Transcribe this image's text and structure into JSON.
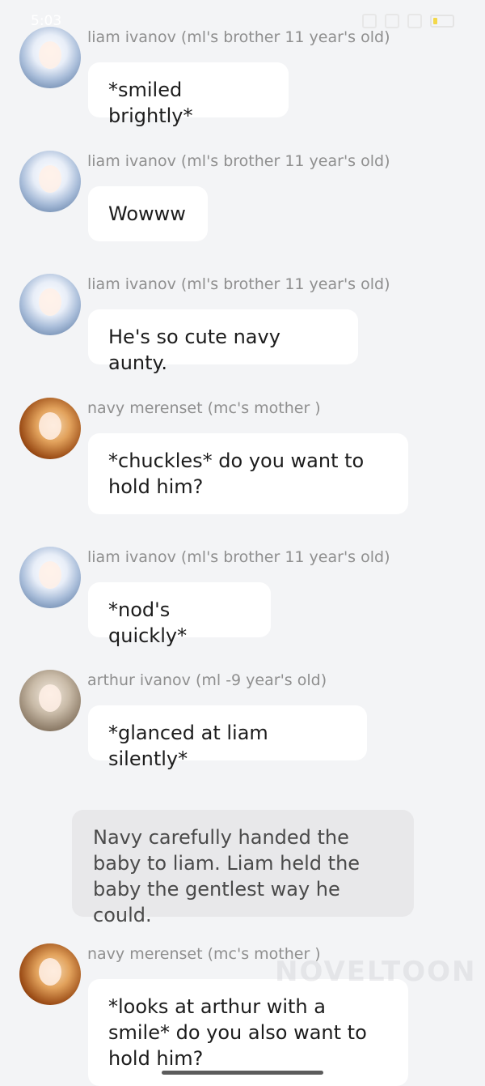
{
  "status_bar": {
    "time": "5:03"
  },
  "messages": [
    {
      "sender": "liam ivanov (ml's brother 11 year's old)",
      "text": "*smiled brightly*"
    },
    {
      "sender": "liam ivanov (ml's brother 11 year's old)",
      "text": "Wowww"
    },
    {
      "sender": "liam ivanov (ml's brother 11 year's old)",
      "text": "He's so cute navy aunty."
    },
    {
      "sender": "navy merenset (mc's mother )",
      "text": "*chuckles* do you want to hold him?"
    },
    {
      "sender": "liam ivanov (ml's brother 11 year's old)",
      "text": "*nod's quickly*"
    },
    {
      "sender": "arthur ivanov (ml -9 year's old)",
      "text": "*glanced at liam silently*"
    },
    {
      "sender": "navy merenset (mc's mother )",
      "text": "*looks at arthur with a smile* do you also want to hold him?"
    }
  ],
  "narration": {
    "text": "Navy carefully handed the baby to liam. Liam held the baby the gentlest way he could."
  },
  "watermark": {
    "text": "NOVELTOON"
  }
}
